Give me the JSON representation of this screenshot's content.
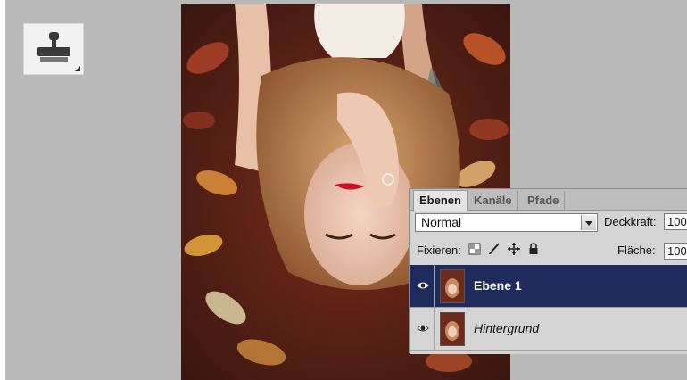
{
  "toolbar": {
    "active_tool": "clone-stamp-icon"
  },
  "canvas": {
    "image": "portrait of a woman lying in autumn leaves"
  },
  "layers_panel": {
    "tabs": [
      {
        "label": "Ebenen",
        "active": true
      },
      {
        "label": "Kanäle",
        "active": false
      },
      {
        "label": "Pfade",
        "active": false
      }
    ],
    "blend_mode": "Normal",
    "opacity_label": "Deckkraft:",
    "opacity_value": "100",
    "lock_label": "Fixieren:",
    "fill_label": "Fläche:",
    "fill_value": "100",
    "layers": [
      {
        "name": "Ebene 1",
        "selected": true,
        "visible": true
      },
      {
        "name": "Hintergrund",
        "selected": false,
        "visible": true
      }
    ]
  },
  "colors": {
    "workspace": "#b9b9b9",
    "selected_layer": "#1f2b5c",
    "panel": "#d4d4d4"
  }
}
